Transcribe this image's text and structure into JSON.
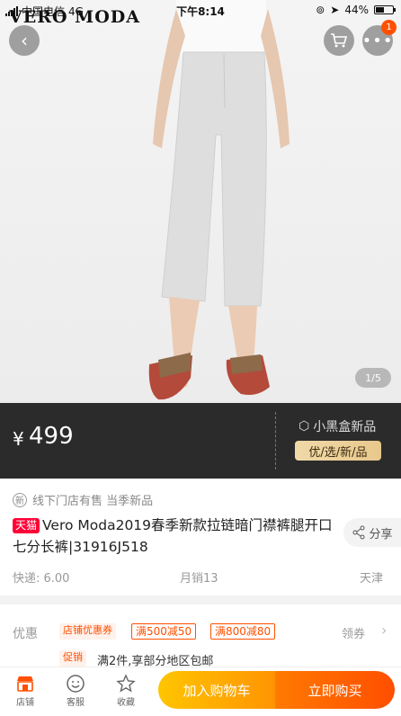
{
  "status_bar": {
    "carrier": "中国电信",
    "network": "4G",
    "time": "下午8:14",
    "battery": "44%",
    "battery_level": 0.44
  },
  "brand": "VERO MODA",
  "header": {
    "cart_badge": "1"
  },
  "gallery": {
    "pager": "1/5"
  },
  "price_bar": {
    "currency": "¥",
    "price": "499",
    "box_title": "小黑盒新品",
    "box_tag": "优/选/新/品"
  },
  "product": {
    "subline_icon": "新",
    "subline": "线下门店有售 当季新品",
    "tmall_tag": "天猫",
    "title": "Vero Moda2019春季新款拉链暗门襟裤腿开口七分长裤|31916J518",
    "share": "分享",
    "shipping": "快递: 6.00",
    "monthly_sales": "月销13",
    "location": "天津"
  },
  "promo": {
    "label": "优惠",
    "store_coupon": "店铺优惠券",
    "coupon1": "满500减50",
    "coupon2": "满800减80",
    "claim": "领券",
    "tip_tag": "促销",
    "tip_text": "满2件,享部分地区包邮"
  },
  "bottom_bar": {
    "store": "店铺",
    "service": "客服",
    "favorite": "收藏",
    "add_to_cart": "加入购物车",
    "buy_now": "立即购买"
  },
  "colors": {
    "accent": "#ff5000",
    "tmall_red": "#ff0036",
    "add_cart_gradient": [
      "#ffc500",
      "#ff9402"
    ],
    "buy_gradient": [
      "#ff7a00",
      "#ff4e00"
    ],
    "price_bar_bg": "#2b2b2b"
  }
}
